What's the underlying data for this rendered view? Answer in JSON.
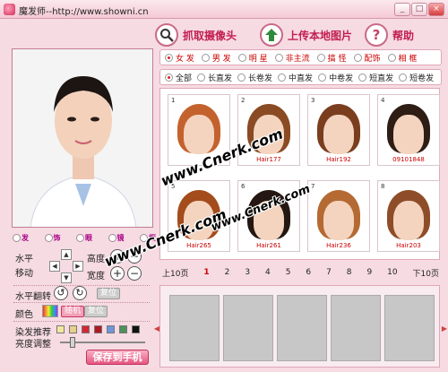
{
  "window": {
    "title": "魔发师--http://www.showni.cn",
    "minimize": "_",
    "maximize": "□",
    "close": "×"
  },
  "header": {
    "camera_label": "抓取摄像头",
    "camera_icon": "magnifier-camera-icon",
    "upload_label": "上传本地图片",
    "upload_icon": "up-arrow-house-icon",
    "help_label": "帮助",
    "help_icon": "?"
  },
  "categories": [
    {
      "label": "女 发",
      "selected": true
    },
    {
      "label": "男 发",
      "selected": false
    },
    {
      "label": "明 星",
      "selected": false
    },
    {
      "label": "非主流",
      "selected": false
    },
    {
      "label": "搞 怪",
      "selected": false
    },
    {
      "label": "配饰",
      "selected": false
    },
    {
      "label": "相 框",
      "selected": false
    }
  ],
  "styles": [
    {
      "label": "全部",
      "selected": true
    },
    {
      "label": "长直发",
      "selected": false
    },
    {
      "label": "长卷发",
      "selected": false
    },
    {
      "label": "中直发",
      "selected": false
    },
    {
      "label": "中卷发",
      "selected": false
    },
    {
      "label": "短直发",
      "selected": false
    },
    {
      "label": "短卷发",
      "selected": false
    }
  ],
  "hairstyles": [
    {
      "num": "1",
      "name": "",
      "hair_color": "#c4622e"
    },
    {
      "num": "2",
      "name": "Hair177",
      "hair_color": "#8a4a23"
    },
    {
      "num": "3",
      "name": "Hair192",
      "hair_color": "#7a3e1f"
    },
    {
      "num": "4",
      "name": "09101848",
      "hair_color": "#2d1d15"
    },
    {
      "num": "5",
      "name": "Hair265",
      "hair_color": "#a44c1c"
    },
    {
      "num": "6",
      "name": "Hair261",
      "hair_color": "#241712"
    },
    {
      "num": "7",
      "name": "Hair236",
      "hair_color": "#b56a33"
    },
    {
      "num": "8",
      "name": "Hair203",
      "hair_color": "#8e4d28"
    }
  ],
  "pager": {
    "prev": "上10页",
    "pages": [
      "1",
      "2",
      "3",
      "4",
      "5",
      "6",
      "7",
      "8",
      "9",
      "10"
    ],
    "current": "1",
    "next": "下10页"
  },
  "left_panel": {
    "mini_radios": [
      "发",
      "饰",
      "眼",
      "镜",
      "框"
    ],
    "horizontal_label": "水平",
    "move_label": "移动",
    "height_label": "高度",
    "width_label": "宽度",
    "flip_label": "水平翻转",
    "reset_label": "复位",
    "color_label": "颜色",
    "random_label": "随机",
    "recommend_label": "染发推荐",
    "brightness_label": "亮度调整",
    "brightness_value": 0.12,
    "save_label": "保存到手机",
    "swatches": [
      "#f3e6a0",
      "#e7d08a",
      "#d32636",
      "#b01822",
      "#6f96d9",
      "#4f8f5c",
      "#111111"
    ]
  },
  "watermark": {
    "text": "www.Cnerk.com"
  }
}
